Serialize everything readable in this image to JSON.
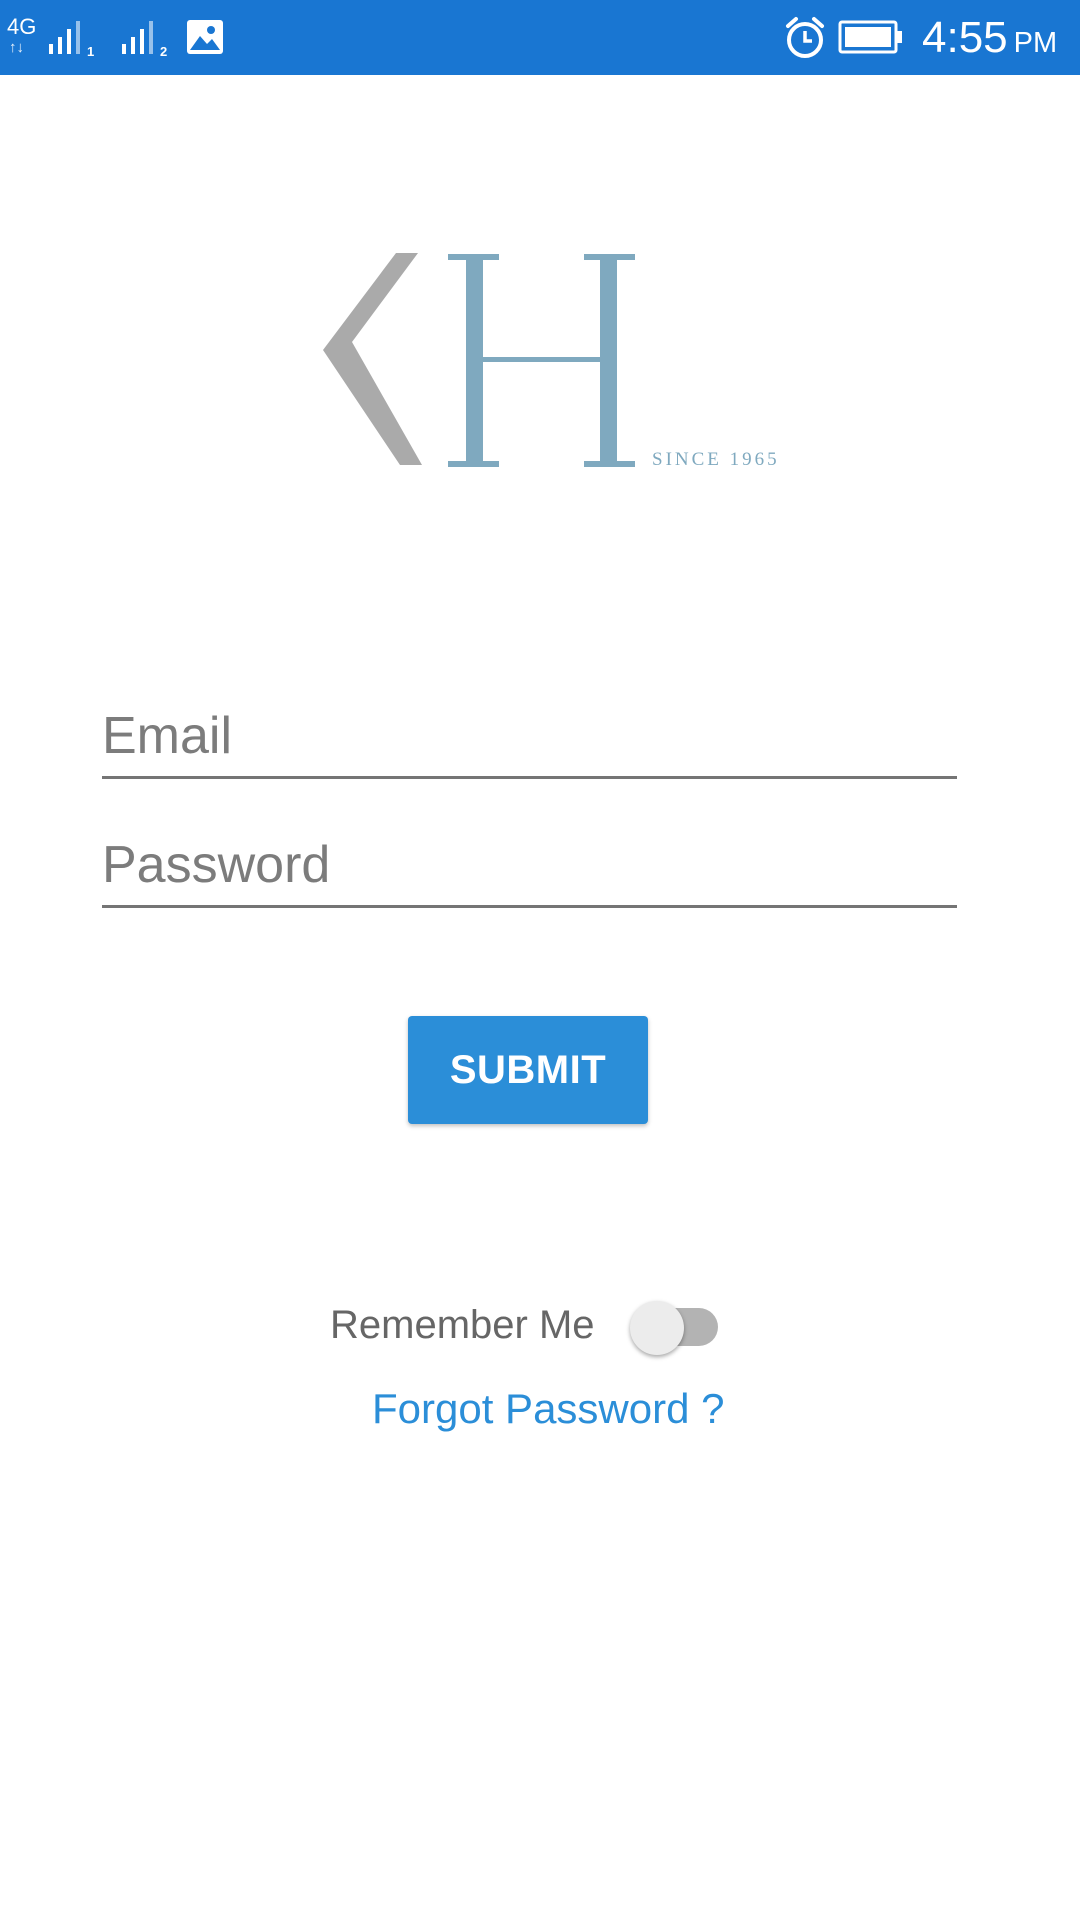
{
  "status_bar": {
    "network": "4G",
    "sim1_index": "1",
    "sim2_index": "2",
    "time": "4:55",
    "ampm": "PM",
    "background_color": "#1976d2",
    "icons": [
      "network-4g-icon",
      "signal-sim1-icon",
      "signal-sim2-icon",
      "gallery-icon",
      "alarm-icon",
      "battery-icon"
    ]
  },
  "logo": {
    "tagline": "SINCE 1965",
    "primary_color": "#7fa9bf",
    "secondary_color": "#aaaaaa"
  },
  "form": {
    "email_placeholder": "Email",
    "email_value": "",
    "password_placeholder": "Password",
    "password_value": "",
    "submit_label": "SUBMIT",
    "accent_color": "#2b8ed8"
  },
  "remember": {
    "label": "Remember Me",
    "enabled": false
  },
  "forgot_password_label": "Forgot Password ?"
}
